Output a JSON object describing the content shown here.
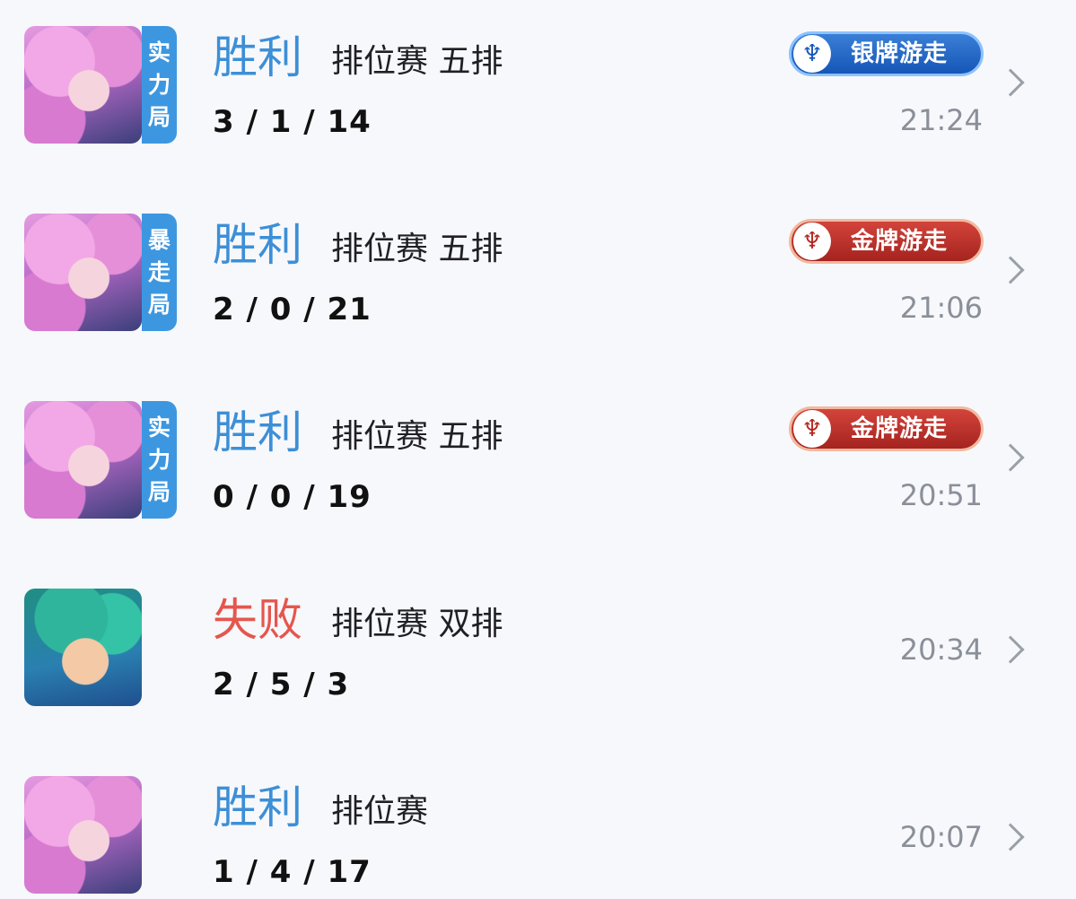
{
  "matches": [
    {
      "avatar": "pink-hair-hero-icon",
      "mode_tag": [
        "实",
        "力",
        "局"
      ],
      "result": "胜利",
      "result_type": "win",
      "mode": "排位赛 五排",
      "kda": "3 / 1 / 14",
      "badge": "银牌游走",
      "badge_type": "silver",
      "time": "21:24"
    },
    {
      "avatar": "pink-hair-hero-icon",
      "mode_tag": [
        "暴",
        "走",
        "局"
      ],
      "result": "胜利",
      "result_type": "win",
      "mode": "排位赛 五排",
      "kda": "2 / 0 / 21",
      "badge": "金牌游走",
      "badge_type": "gold",
      "time": "21:06"
    },
    {
      "avatar": "pink-hair-hero-icon",
      "mode_tag": [
        "实",
        "力",
        "局"
      ],
      "result": "胜利",
      "result_type": "win",
      "mode": "排位赛 五排",
      "kda": "0 / 0 / 19",
      "badge": "金牌游走",
      "badge_type": "gold",
      "time": "20:51"
    },
    {
      "avatar": "green-hair-hero-icon",
      "mode_tag": [],
      "result": "失败",
      "result_type": "lose",
      "mode": "排位赛 双排",
      "kda": "2 / 5 / 3",
      "badge": "",
      "badge_type": "",
      "time": "20:34"
    },
    {
      "avatar": "pink-hair-hero-icon",
      "mode_tag": [],
      "result": "胜利",
      "result_type": "win",
      "mode": "排位赛",
      "kda": "1 / 4 / 17",
      "badge": "",
      "badge_type": "",
      "time": "20:07"
    }
  ],
  "colors": {
    "win": "#3d8fd6",
    "lose": "#e5564d",
    "mode_tag_bg": "#3d97e0",
    "silver_badge": "#1556b8",
    "gold_badge": "#a5231f",
    "time_text": "#8a8f99",
    "background": "#f7f8fb"
  }
}
